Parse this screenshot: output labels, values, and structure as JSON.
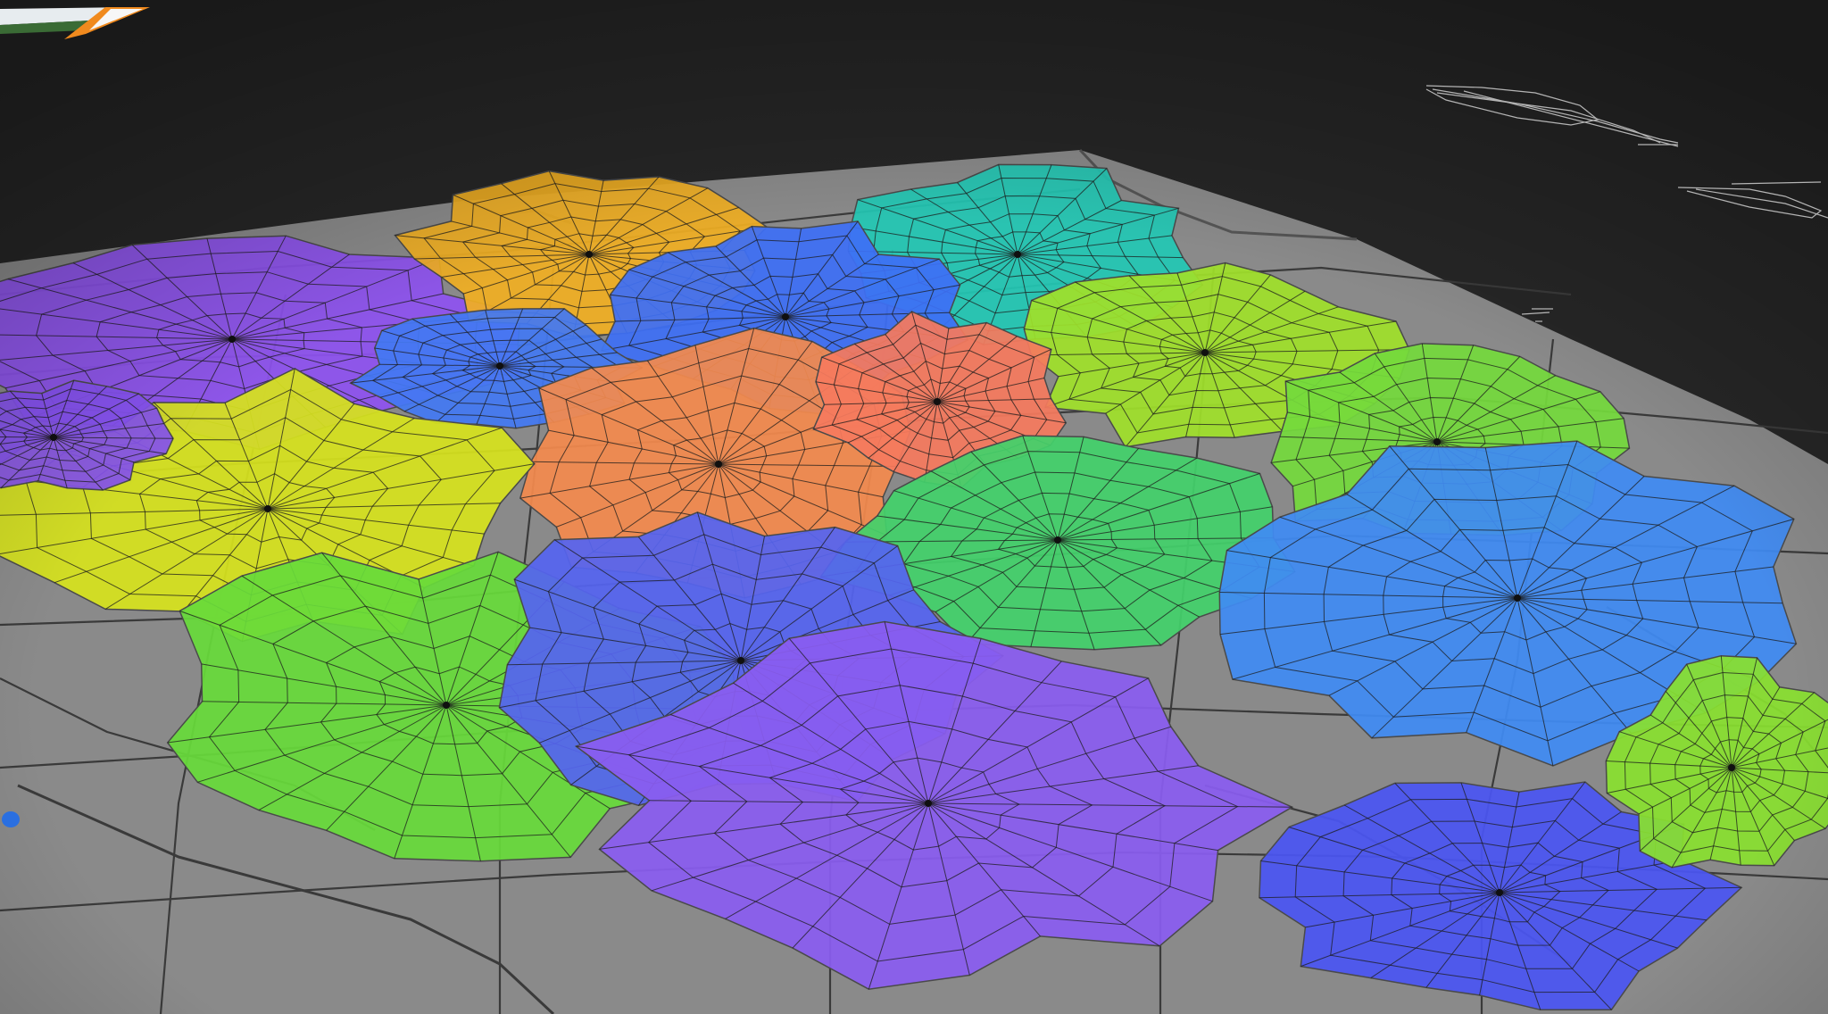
{
  "view": {
    "type": "3d-perspective-coverage-map",
    "background_color": "#262626",
    "ground_color": "#8a8a8a",
    "road_line_color": "#3a3a3a",
    "mesh_line_color": "#1c1c1c"
  },
  "hubs": [
    {
      "name": "hub-purple-west",
      "color": "#8e52f0"
    },
    {
      "name": "hub-yellow-north",
      "color": "#f0ae22"
    },
    {
      "name": "hub-teal-north",
      "color": "#22c7b4"
    },
    {
      "name": "hub-blue-north",
      "color": "#3d6ff5"
    },
    {
      "name": "hub-blue-small",
      "color": "#4378f2"
    },
    {
      "name": "hub-lime-northeast",
      "color": "#9fe02a"
    },
    {
      "name": "hub-orange-center",
      "color": "#f38a4e"
    },
    {
      "name": "hub-salmon-center",
      "color": "#f57a5e"
    },
    {
      "name": "hub-yellow-west",
      "color": "#d6e21d"
    },
    {
      "name": "hub-green-east",
      "color": "#74d93c"
    },
    {
      "name": "hub-green-center",
      "color": "#43d16a"
    },
    {
      "name": "hub-lime-southwest",
      "color": "#67da3a"
    },
    {
      "name": "hub-blue-center",
      "color": "#5564f0"
    },
    {
      "name": "hub-blue-east",
      "color": "#3f8bf3"
    },
    {
      "name": "hub-violet-south",
      "color": "#8a5cf0"
    },
    {
      "name": "hub-indigo-southeast",
      "color": "#4a55f2"
    },
    {
      "name": "hub-lime-southeast",
      "color": "#89e02f"
    },
    {
      "name": "hub-violet-west",
      "color": "#8552ee"
    }
  ]
}
